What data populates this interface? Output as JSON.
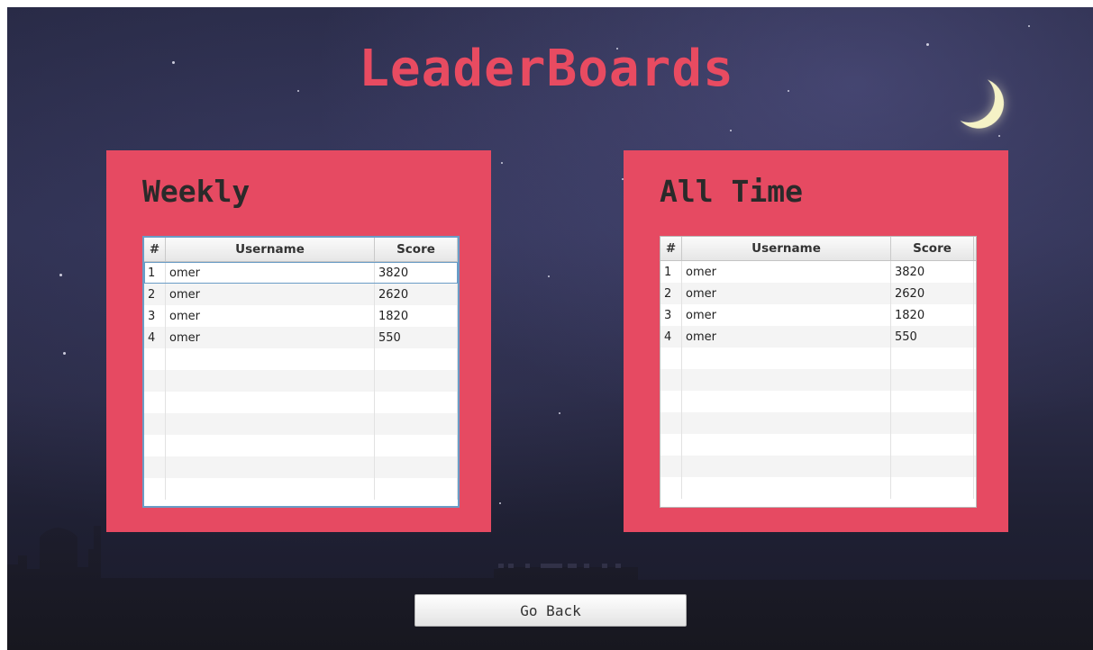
{
  "title": "LeaderBoards",
  "weekly": {
    "heading": "Weekly",
    "columns": [
      "#",
      "Username",
      "Score"
    ],
    "rows": [
      {
        "rank": "1",
        "username": "omer",
        "score": "3820"
      },
      {
        "rank": "2",
        "username": "omer",
        "score": "2620"
      },
      {
        "rank": "3",
        "username": "omer",
        "score": "1820"
      },
      {
        "rank": "4",
        "username": "omer",
        "score": "550"
      }
    ]
  },
  "all_time": {
    "heading": "All Time",
    "columns": [
      "#",
      "Username",
      "Score"
    ],
    "rows": [
      {
        "rank": "1",
        "username": "omer",
        "score": "3820"
      },
      {
        "rank": "2",
        "username": "omer",
        "score": "2620"
      },
      {
        "rank": "3",
        "username": "omer",
        "score": "1820"
      },
      {
        "rank": "4",
        "username": "omer",
        "score": "550"
      }
    ]
  },
  "go_back_label": "Go Back",
  "colors": {
    "accent": "#e84b61",
    "panel": "#e64a62",
    "sky": "#2d2f4e",
    "selection": "#6a9cc6"
  }
}
